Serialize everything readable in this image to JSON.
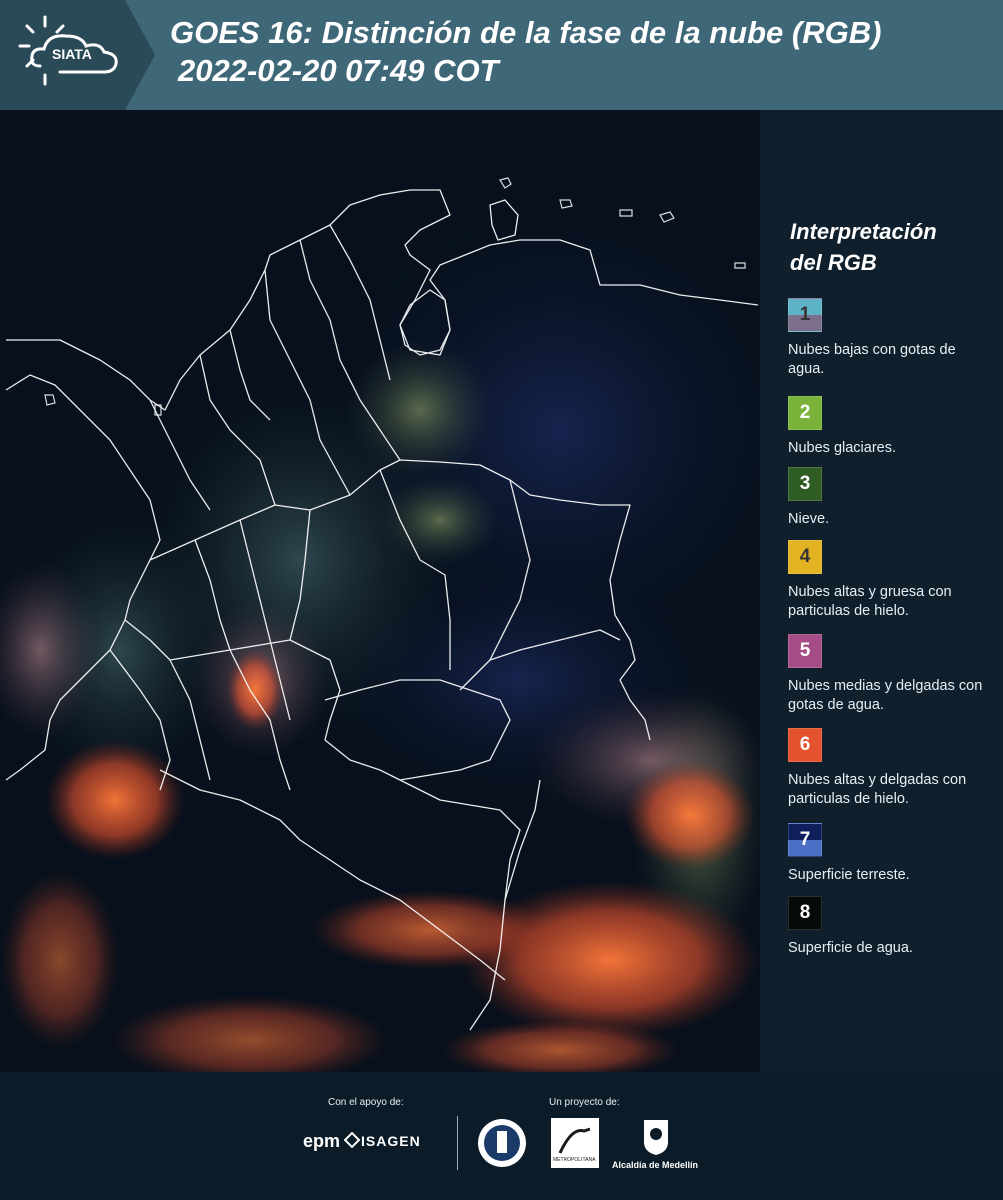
{
  "header": {
    "logo_text": "SIATA",
    "title_line1": "GOES 16: Distinción de la fase de la nube (RGB)",
    "title_line2": "2022-02-20 07:49 COT"
  },
  "legend": {
    "title_line1": "Interpretación",
    "title_line2": "del RGB",
    "items": [
      {
        "num": "1",
        "label": "Nubes bajas con gotas de agua.",
        "color_top": "#5fb3c6",
        "color_bottom": "#7c6f8c",
        "num_color": "#333333"
      },
      {
        "num": "2",
        "label": "Nubes glaciares.",
        "color_top": "#7bb33a",
        "color_bottom": "#7bb33a",
        "num_color": "#ffffff"
      },
      {
        "num": "3",
        "label": "Nieve.",
        "color_top": "#2f5c22",
        "color_bottom": "#2f5c22",
        "num_color": "#ffffff"
      },
      {
        "num": "4",
        "label": "Nubes altas y gruesa con particulas de hielo.",
        "color_top": "#e3b324",
        "color_bottom": "#e3b324",
        "num_color": "#333333"
      },
      {
        "num": "5",
        "label": "Nubes medias y delgadas con gotas de agua.",
        "color_top": "#a64c87",
        "color_bottom": "#a64c87",
        "num_color": "#ffffff"
      },
      {
        "num": "6",
        "label": "Nubes altas y delgadas con particulas de hielo.",
        "color_top": "#e5522e",
        "color_bottom": "#e5522e",
        "num_color": "#ffffff"
      },
      {
        "num": "7",
        "label": "Superficie terreste.",
        "color_top": "#0f1f5e",
        "color_bottom": "#4a6fc4",
        "num_color": "#ffffff"
      },
      {
        "num": "8",
        "label": "Superficie de agua.",
        "color_top": "#060b0a",
        "color_bottom": "#060b0a",
        "num_color": "#ffffff"
      }
    ]
  },
  "footer": {
    "support_label": "Con el apoyo de:",
    "project_label": "Un proyecto de:",
    "sponsor1": "epm",
    "sponsor2": "ISAGEN",
    "partner1": "Área",
    "partner1_sub": "METROPOLITANA",
    "partner2": "Alcaldía de Medellín"
  }
}
